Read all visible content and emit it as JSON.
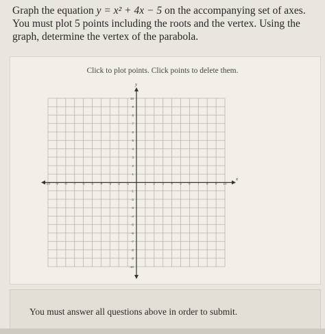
{
  "question": {
    "line1_prefix": "Graph the equation ",
    "equation": "y = x² + 4x − 5",
    "line1_suffix": " on the accompanying set of axes. You must plot 5 points including the roots and the vertex. Using the graph, determine the vertex of the parabola."
  },
  "graph": {
    "instructions": "Click to plot points. Click points to delete them.",
    "x_axis_label": "x",
    "y_axis_label": "y",
    "x_range": [
      -10,
      10
    ],
    "y_range": [
      -10,
      10
    ],
    "x_ticks": [
      "-10",
      "-9",
      "-8",
      "-7",
      "-6",
      "-5",
      "-4",
      "-3",
      "-2",
      "-1",
      "1",
      "2",
      "3",
      "4",
      "5",
      "6",
      "7",
      "8",
      "9",
      "10"
    ],
    "y_ticks": [
      "10",
      "9",
      "8",
      "7",
      "6",
      "5",
      "4",
      "3",
      "2",
      "1",
      "-1",
      "-2",
      "-3",
      "-4",
      "-5",
      "-6",
      "-7",
      "-8",
      "-9",
      "-10"
    ]
  },
  "footer": {
    "message": "You must answer all questions above in order to submit."
  },
  "colors": {
    "grid": "#b9b5ad",
    "axis": "#333333",
    "background": "#f2efe9"
  }
}
